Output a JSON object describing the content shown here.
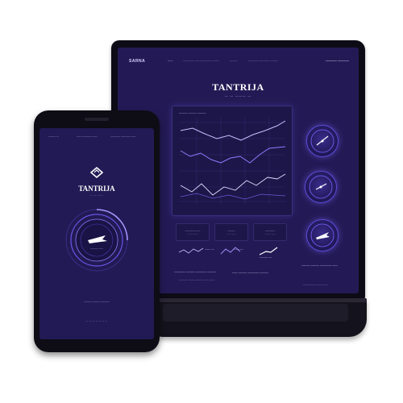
{
  "laptop": {
    "brand": "SARNA",
    "nav": [
      "——",
      "———— —— ———— ———",
      "———",
      "———— ———— ———"
    ],
    "nav_right": "———— ————",
    "hero_title": "TANTRIJA",
    "hero_sub": "— — ——— —",
    "chart_label": "——— ——— ———",
    "stats": [
      {
        "title": "———— ——",
        "sub": "——— ——"
      },
      {
        "title": "———",
        "sub": "—— ——"
      },
      {
        "title": "————",
        "sub": "——— ——"
      }
    ],
    "mini_values": [
      "—— —",
      "—— —",
      "——— —"
    ],
    "footer_left": "———— ——— ———— ———",
    "footer_left_small": "———— ——— ———— —— ———",
    "footer_mid": "—— ——— ———— ———",
    "footer_right": "——— ——— ———— ——",
    "footer_right_small": "——— ——— ——— ——"
  },
  "phone": {
    "status_left": "——— —",
    "status_mid": "—— ———— ——",
    "status_right": "———— ———— ——",
    "title": "TANTRIJA",
    "subtitle": "— — ——",
    "dial_text": "———— ——",
    "bottom_text": "——— ——— ————",
    "bottom_small": "— — — — — — —"
  },
  "colors": {
    "screen_bg": "#231a55",
    "accent": "#7b63ff",
    "line_light": "#c9bfff",
    "device_body": "#0e0c15"
  },
  "icons": {
    "brand_logo": "chevron-logo-icon",
    "gauge_needle": "needle-icon",
    "dial_icon": "plane-icon"
  }
}
